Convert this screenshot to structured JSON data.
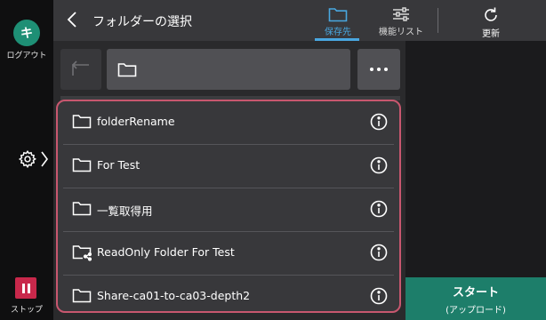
{
  "sidebar": {
    "avatar_letter": "キ",
    "logout_label": "ログアウト",
    "settings_icon": "gear-icon",
    "stop_label": "ストップ",
    "stop_color": "#c8284b"
  },
  "header": {
    "title": "フォルダーの選択",
    "tabs": [
      {
        "label": "保存先",
        "icon": "folder-icon",
        "active": true
      },
      {
        "label": "機能リスト",
        "icon": "sliders-icon",
        "active": false
      }
    ],
    "refresh_label": "更新",
    "accent_color": "#49a7e0"
  },
  "path": {
    "up_icon": "up-arrow-icon",
    "current_folder_icon": "folder-icon",
    "more_icon": "ellipsis-icon"
  },
  "folders": [
    {
      "name": "folderRename",
      "icon": "folder-icon"
    },
    {
      "name": "For Test",
      "icon": "folder-icon"
    },
    {
      "name": "一覧取得用",
      "icon": "folder-icon"
    },
    {
      "name": "ReadOnly Folder For Test",
      "icon": "shared-folder-icon"
    },
    {
      "name": "Share-ca01-to-ca03-depth2",
      "icon": "folder-icon"
    }
  ],
  "start_button": {
    "label": "スタート",
    "sublabel": "(アップロード)",
    "color": "#1d7e6a"
  },
  "highlight_color": "#c8576f"
}
